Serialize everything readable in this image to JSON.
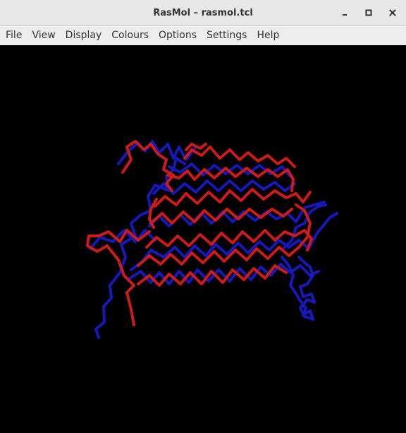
{
  "window": {
    "title": "RasMol – rasmol.tcl",
    "controls": [
      "minimize-icon",
      "maximize-icon",
      "close-icon"
    ]
  },
  "menubar": {
    "items": [
      {
        "label": "File"
      },
      {
        "label": "View"
      },
      {
        "label": "Display"
      },
      {
        "label": "Colours"
      },
      {
        "label": "Options"
      },
      {
        "label": "Settings"
      },
      {
        "label": "Help"
      }
    ]
  },
  "viewport": {
    "background": "#000000",
    "chain_colors": [
      "#cc1b1b",
      "#1818b8"
    ]
  }
}
